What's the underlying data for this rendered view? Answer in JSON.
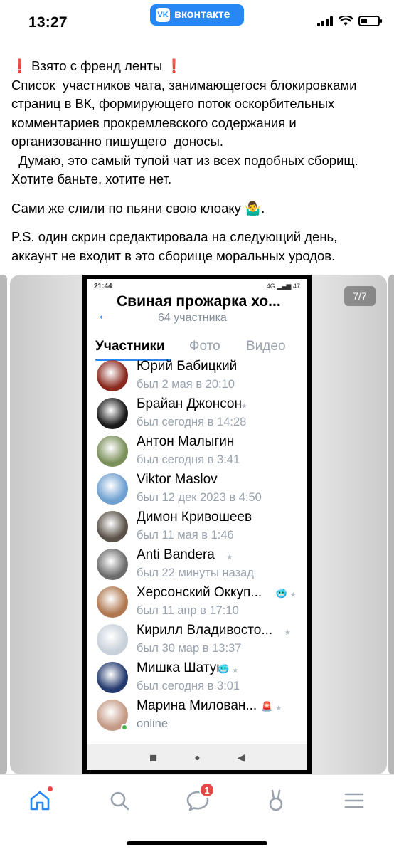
{
  "status_bar": {
    "time": "13:27",
    "app_pill": "вконтакте",
    "vk_logo": "VK"
  },
  "post": {
    "paragraphs": [
      {
        "lead": "❗",
        "text": " Взято с френд ленты ",
        "tail": "❗",
        "rest": "\nСписок  участников чата, занимающегося блокировками страниц в ВК, формирующего поток оскорбительных комментариев прокремлевского содержания и организованно пишущего  доносы.\n  Думаю, это самый тупой чат из всех подобных сборищ. Хотите баньте, хотите нет."
      },
      {
        "text": "Сами же слили по пьяни свою клоаку 🤷‍♂️."
      },
      {
        "text": "P.S. один скрин средактировала на следующий день, аккаунт не входит в это сборище моральных уродов."
      }
    ]
  },
  "carousel": {
    "counter": "7/7"
  },
  "screenshot": {
    "status_time": "21:44",
    "status_icons": "4G ▂▄▆ 47",
    "back_icon": "arrow-left-icon",
    "chat_title": "Свиная прожарка хо...",
    "members_count": "64 участника",
    "tabs": [
      "Участники",
      "Фото",
      "Видео"
    ],
    "members": [
      {
        "name": "Юрий Бабицкий",
        "status": "был 2 мая в 20:10",
        "avatar_color": "#8a2a1e",
        "star": false,
        "badge": ""
      },
      {
        "name": "Брайан Джонсон",
        "status": "был сегодня в 14:28",
        "avatar_color": "#1a1a1a",
        "star": true,
        "badge": ""
      },
      {
        "name": "Антон Малыгин",
        "status": "был сегодня в 3:41",
        "avatar_color": "#7a8f5a",
        "star": false,
        "badge": ""
      },
      {
        "name": "Viktor Maslov",
        "status": "был 12 дек 2023 в 4:50",
        "avatar_color": "#6d9fd0",
        "star": false,
        "badge": ""
      },
      {
        "name": "Димон Кривошеев",
        "status": "был 11 мая в 1:46",
        "avatar_color": "#5a5148",
        "star": false,
        "badge": ""
      },
      {
        "name": "Anti Bandera",
        "status": "был 22 минуты назад",
        "avatar_color": "#6c6c6c",
        "star": true,
        "badge": ""
      },
      {
        "name": "Херсонский Оккуп...",
        "status": "был 11 апр в 17:10",
        "avatar_color": "#b07850",
        "star": true,
        "badge": "🥶"
      },
      {
        "name": "Кирилл Владивосто...",
        "status": "был 30 мар в 13:37",
        "avatar_color": "#c8d0da",
        "star": true,
        "badge": ""
      },
      {
        "name": "Мишка Шатун",
        "status": "был сегодня в 3:01",
        "avatar_color": "#233a6e",
        "star": true,
        "badge": "🥶"
      },
      {
        "name": "Марина Милован...",
        "status": "online",
        "avatar_color": "#c49a86",
        "star": true,
        "badge": "🚨",
        "online": true
      }
    ],
    "navbar": [
      "◼",
      "●",
      "◀"
    ]
  },
  "tabbar": {
    "items": [
      {
        "icon": "home-icon",
        "active": true,
        "dot": true
      },
      {
        "icon": "search-icon"
      },
      {
        "icon": "messages-icon",
        "badge": "1"
      },
      {
        "icon": "clips-icon"
      },
      {
        "icon": "menu-icon"
      }
    ]
  },
  "colors": {
    "accent": "#2787f5",
    "alert": "#e64646",
    "muted": "#99a2ad"
  }
}
